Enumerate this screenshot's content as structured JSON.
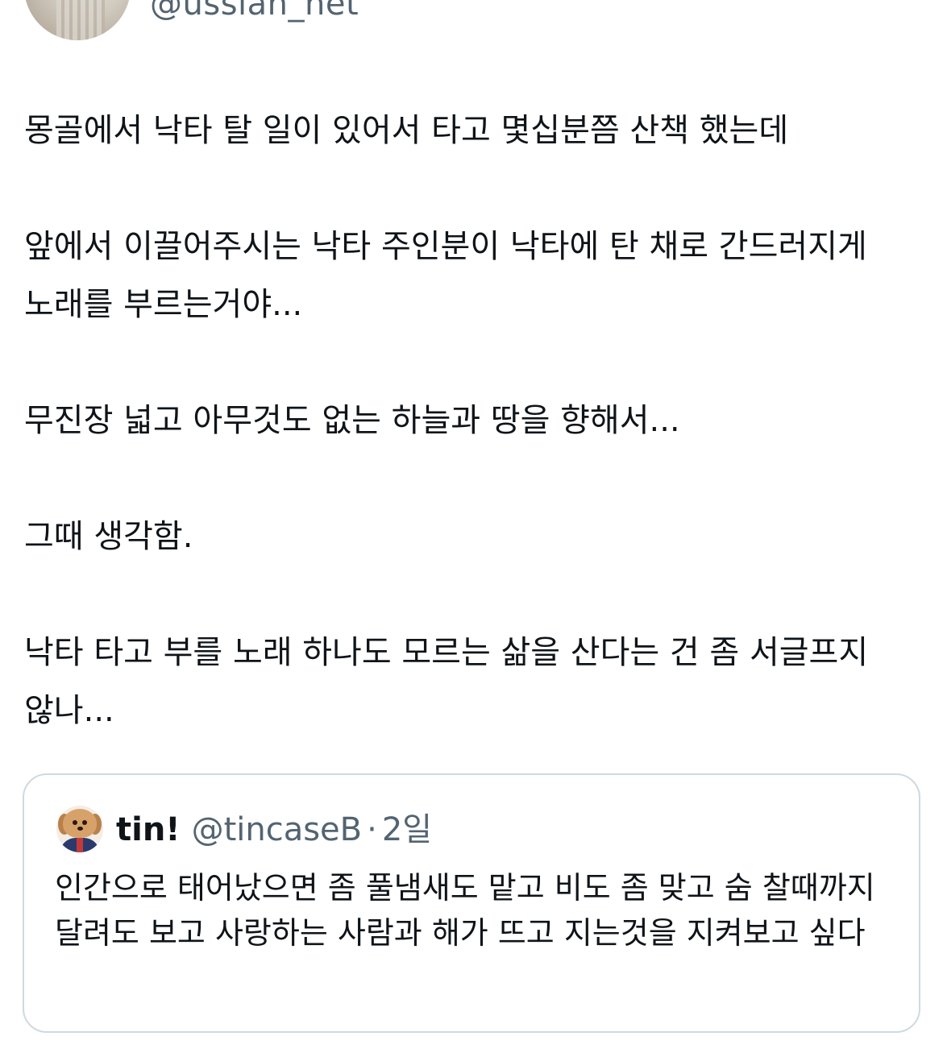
{
  "author": {
    "handle": "@ussian_net"
  },
  "tweet": {
    "paragraphs": [
      "몽골에서 낙타 탈 일이 있어서 타고 몇십분쯤 산책 했는데",
      "앞에서 이끌어주시는 낙타 주인분이 낙타에 탄 채로 간드러지게 노래를 부르는거야...",
      "무진장 넓고 아무것도 없는 하늘과 땅을 향해서...",
      "그때 생각함.",
      "낙타 타고 부를 노래 하나도 모르는 삶을 산다는 건 좀 서글프지 않나..."
    ]
  },
  "quoted_tweet": {
    "name": "tin!",
    "handle": "@tincaseB",
    "separator": "·",
    "time": "2일",
    "text": "인간으로 태어났으면 좀 풀냄새도 맡고 비도 좀 맞고 숨 찰때까지 달려도 보고 사랑하는 사람과 해가 뜨고 지는것을 지켜보고 싶다",
    "avatar_icon": "puppy-in-suit-icon"
  },
  "colors": {
    "text": "#0f1419",
    "secondary": "#536471",
    "border": "#cfd9de"
  }
}
